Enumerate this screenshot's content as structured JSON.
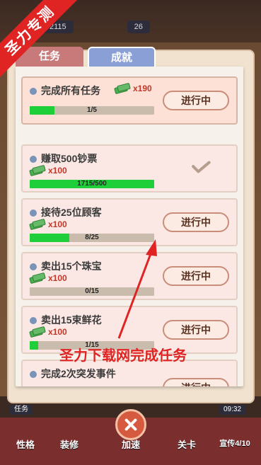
{
  "watermark": "圣力专测",
  "top_bar": {
    "left_value": "2115",
    "right_value": "26"
  },
  "tabs": {
    "tasks": "任务",
    "achievements": "成就"
  },
  "cards": [
    {
      "title": "完成所有任务",
      "reward": "x190",
      "progress_label": "1/5",
      "progress": 0.2,
      "status": "进行中",
      "completed": false
    },
    {
      "title": "赚取500钞票",
      "reward": "x100",
      "progress_label": "1715/500",
      "progress": 1.0,
      "status": "",
      "completed": true
    },
    {
      "title": "接待25位顾客",
      "reward": "x100",
      "progress_label": "8/25",
      "progress": 0.32,
      "status": "进行中",
      "completed": false
    },
    {
      "title": "卖出15个珠宝",
      "reward": "x100",
      "progress_label": "0/15",
      "progress": 0.0,
      "status": "进行中",
      "completed": false
    },
    {
      "title": "卖出15束鲜花",
      "reward": "x100",
      "progress_label": "1/15",
      "progress": 0.067,
      "status": "进行中",
      "completed": false
    },
    {
      "title": "完成2次突发事件",
      "reward": "",
      "progress_label": "",
      "progress": 0.0,
      "status": "进行中",
      "completed": false
    }
  ],
  "overlay_text": "圣力下载网完成任务",
  "bottom_bar": {
    "task_label": "任务",
    "time": "09:32",
    "items": [
      "性格",
      "装修",
      "加速",
      "关卡",
      "宣传4/10"
    ]
  },
  "colors": {
    "accent_red": "#e02424",
    "progress_green": "#1fcf3a",
    "reward_red": "#c0392b"
  }
}
